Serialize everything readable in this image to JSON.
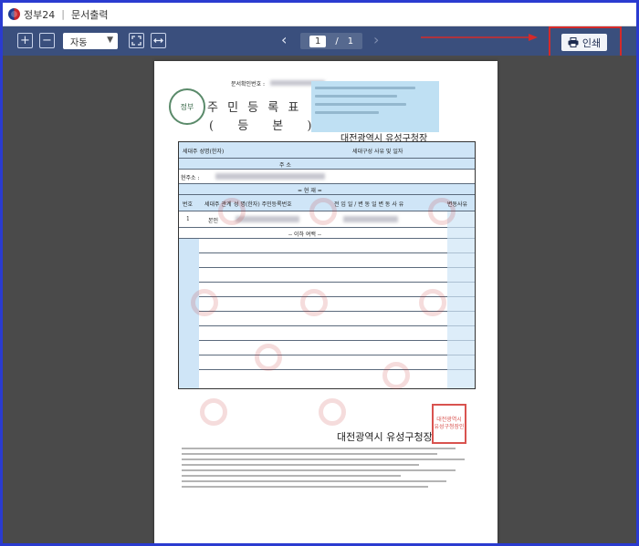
{
  "titlebar": {
    "app": "정부24",
    "separator": "|",
    "title": "문서출력"
  },
  "toolbar": {
    "zoom_in_icon": "plus-square-icon",
    "zoom_out_icon": "minus-square-icon",
    "zoom_value": "자동",
    "fit_page_icon": "fit-page-icon",
    "fit_width_icon": "fit-width-icon",
    "page_current": "1",
    "page_separator": "/",
    "page_total": "1",
    "print_label": "인쇄",
    "print_icon": "printer-icon"
  },
  "document": {
    "doc_number_label": "문서확인번호 :",
    "title_main": "주 민 등 록 표",
    "title_sub": "( 등  본 )",
    "office": "대전광역시 유성구청장",
    "table": {
      "household_head_label": "세대주 성명(한자)",
      "household_reason_label": "세대구성 사유 및 일자",
      "address_header": "주 소",
      "current_address_label": "현주소 :",
      "section_label": "= 현 재 =",
      "col_number": "번호",
      "col_relation": "세대주 관계",
      "col_name": "성 명(한자) 주민등록번호",
      "col_date": "전 입 일 / 변 동 일 변 동 사 유",
      "col_change_reason": "변동사유",
      "row1_number": "1",
      "row1_relation": "본인",
      "end_marker": "-- 이하 여백 --"
    },
    "seal_text": "대전광역시 유성구청장인"
  },
  "colors": {
    "toolbar_bg": "#3a4f7d",
    "viewer_bg": "#4a4a4a",
    "highlight": "#d52a2a",
    "form_blue": "#cfe5f7"
  }
}
